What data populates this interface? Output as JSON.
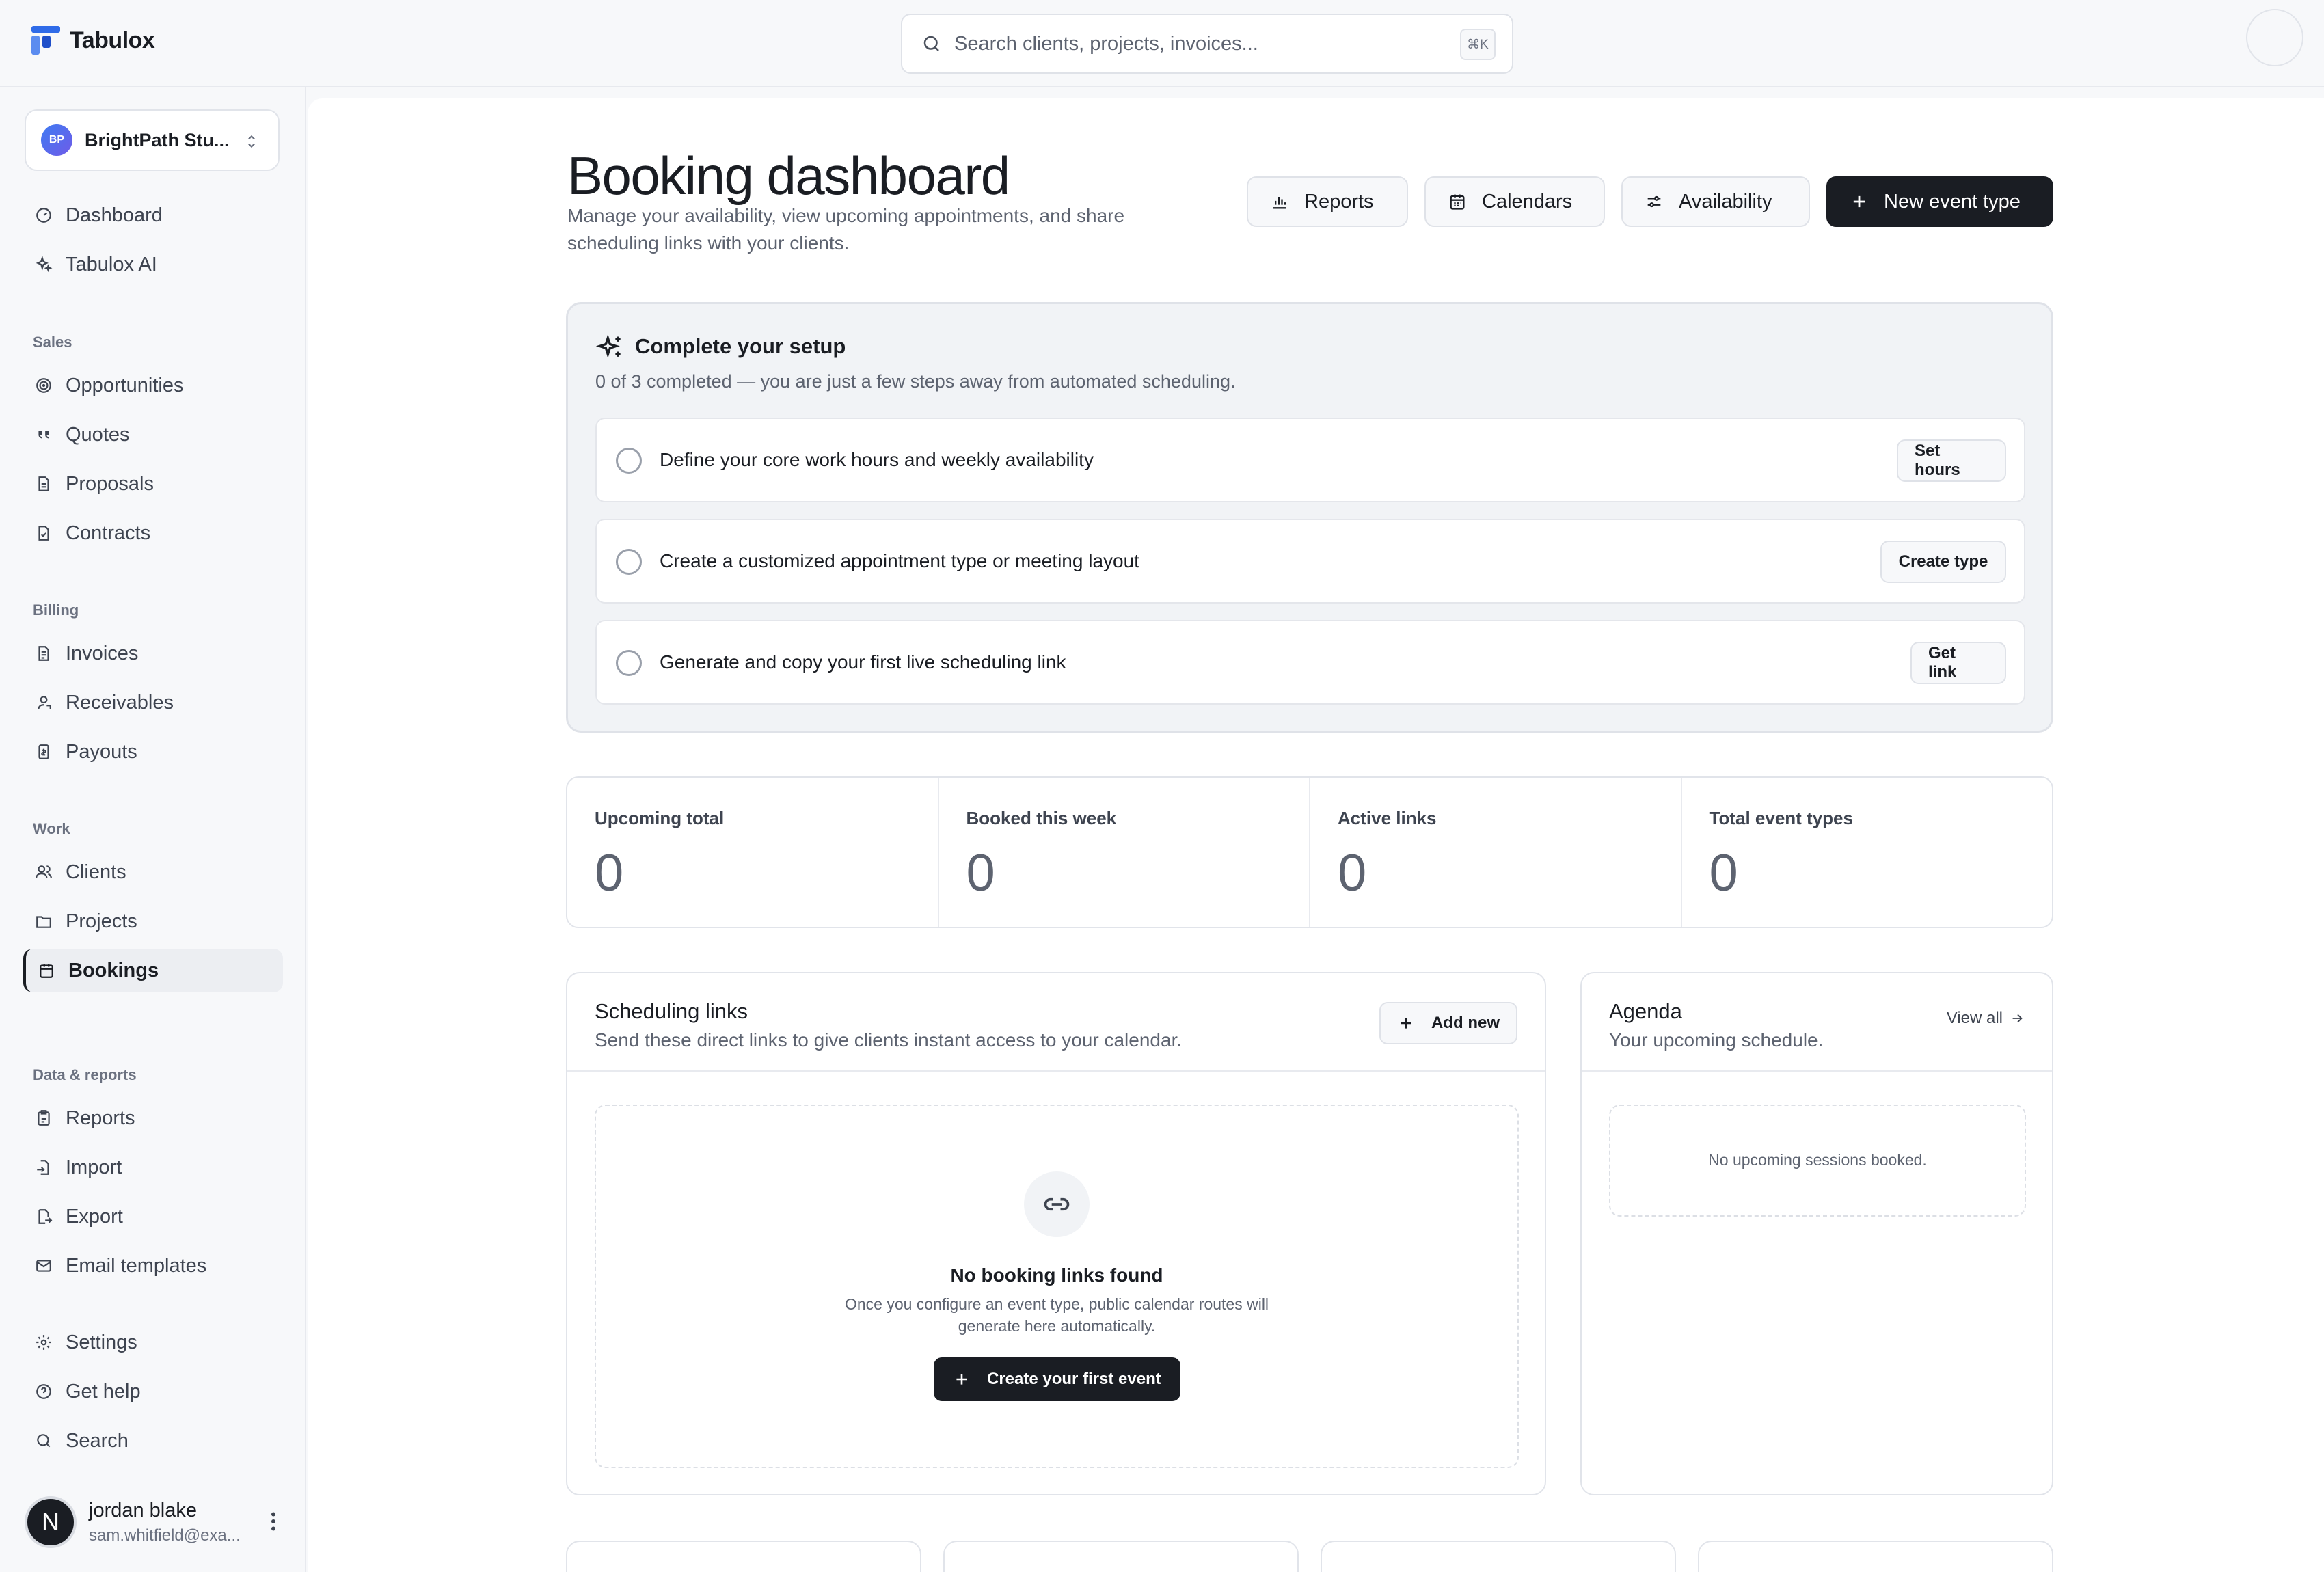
{
  "app": {
    "name": "Tabulox"
  },
  "search": {
    "placeholder": "Search clients, projects, invoices...",
    "shortcut": "⌘K"
  },
  "org": {
    "initials": "BP",
    "name": "BrightPath Stu..."
  },
  "sidebar": {
    "top_items": [
      {
        "label": "Dashboard",
        "icon": "dashboard-icon"
      },
      {
        "label": "Tabulox AI",
        "icon": "sparkle-icon"
      }
    ],
    "sections": [
      {
        "title": "Sales",
        "items": [
          {
            "label": "Opportunities",
            "icon": "target-icon"
          },
          {
            "label": "Quotes",
            "icon": "quote-icon"
          },
          {
            "label": "Proposals",
            "icon": "document-icon"
          },
          {
            "label": "Contracts",
            "icon": "contract-icon"
          }
        ]
      },
      {
        "title": "Billing",
        "items": [
          {
            "label": "Invoices",
            "icon": "invoice-icon"
          },
          {
            "label": "Receivables",
            "icon": "receivables-icon"
          },
          {
            "label": "Payouts",
            "icon": "payout-icon"
          }
        ]
      },
      {
        "title": "Work",
        "items": [
          {
            "label": "Clients",
            "icon": "users-icon"
          },
          {
            "label": "Projects",
            "icon": "folder-icon"
          },
          {
            "label": "Bookings",
            "icon": "calendar-icon",
            "active": true
          }
        ]
      },
      {
        "title": "Data & reports",
        "items": [
          {
            "label": "Reports",
            "icon": "report-icon"
          },
          {
            "label": "Import",
            "icon": "import-icon"
          },
          {
            "label": "Export",
            "icon": "export-icon"
          },
          {
            "label": "Email templates",
            "icon": "mail-icon"
          }
        ]
      }
    ],
    "bottom_items": [
      {
        "label": "Settings",
        "icon": "gear-icon"
      },
      {
        "label": "Get help",
        "icon": "help-icon"
      },
      {
        "label": "Search",
        "icon": "search-icon"
      }
    ]
  },
  "user": {
    "initial": "N",
    "name": "jordan blake",
    "email": "sam.whitfield@exa..."
  },
  "header": {
    "title": "Booking dashboard",
    "subtitle": "Manage your availability, view upcoming appointments, and share scheduling links with your clients.",
    "buttons": {
      "reports": "Reports",
      "calendars": "Calendars",
      "availability": "Availability",
      "new_event": "New event type"
    }
  },
  "setup": {
    "title": "Complete your setup",
    "subtitle": "0 of 3 completed — you are just a few steps away from automated scheduling.",
    "tasks": [
      {
        "label": "Define your core work hours and weekly availability",
        "action": "Set hours"
      },
      {
        "label": "Create a customized appointment type or meeting layout",
        "action": "Create type"
      },
      {
        "label": "Generate and copy your first live scheduling link",
        "action": "Get link"
      }
    ]
  },
  "stats": [
    {
      "label": "Upcoming total",
      "value": "0"
    },
    {
      "label": "Booked this week",
      "value": "0"
    },
    {
      "label": "Active links",
      "value": "0"
    },
    {
      "label": "Total event types",
      "value": "0"
    }
  ],
  "links_card": {
    "title": "Scheduling links",
    "subtitle": "Send these direct links to give clients instant access to your calendar.",
    "add_label": "Add new",
    "empty_title": "No booking links found",
    "empty_desc": "Once you configure an event type, public calendar routes will generate here automatically.",
    "create_label": "Create your first event"
  },
  "agenda_card": {
    "title": "Agenda",
    "subtitle": "Your upcoming schedule.",
    "view_all": "View all",
    "empty": "No upcoming sessions booked."
  },
  "colors": {
    "primary": "#1a1d23",
    "accent": "#2f6be8",
    "muted": "#5d6370"
  }
}
